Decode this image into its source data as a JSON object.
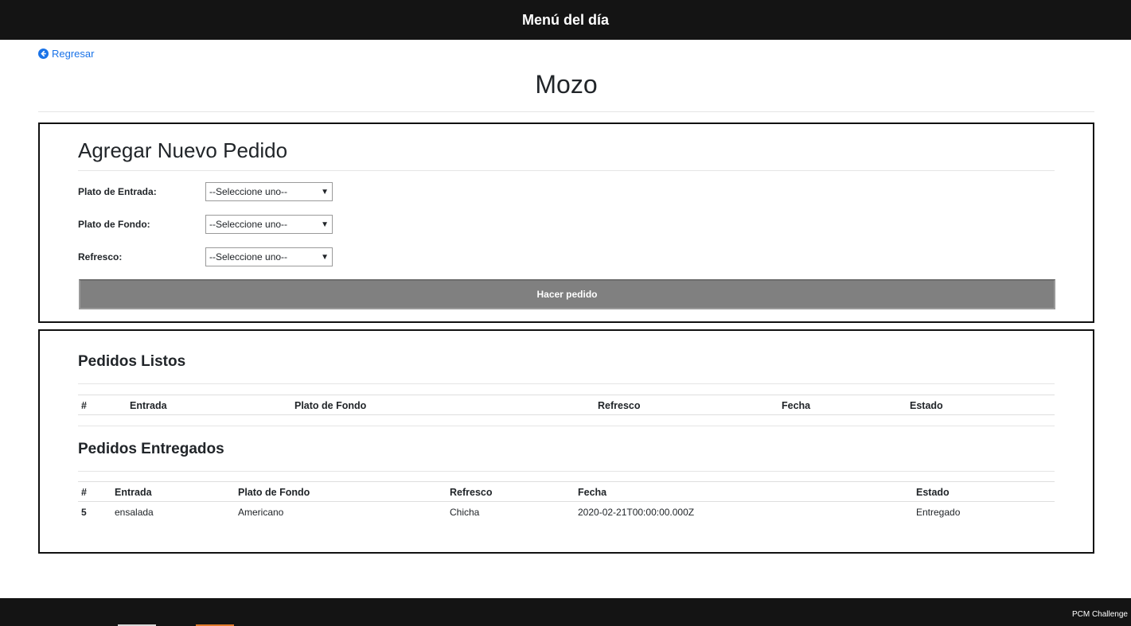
{
  "header": {
    "title": "Menú del día"
  },
  "nav": {
    "back_label": "Regresar",
    "back_icon": "arrow-circle-left-icon"
  },
  "page": {
    "title": "Mozo"
  },
  "form": {
    "title": "Agregar Nuevo Pedido",
    "fields": [
      {
        "label": "Plato de Entrada:",
        "selected": "--Seleccione uno--"
      },
      {
        "label": "Plato de Fondo:",
        "selected": "--Seleccione uno--"
      },
      {
        "label": "Refresco:",
        "selected": "--Seleccione uno--"
      }
    ],
    "submit_label": "Hacer pedido"
  },
  "ready": {
    "title": "Pedidos Listos",
    "columns": [
      "#",
      "Entrada",
      "Plato de Fondo",
      "Refresco",
      "Fecha",
      "Estado"
    ],
    "rows": []
  },
  "delivered": {
    "title": "Pedidos Entregados",
    "columns": [
      "#",
      "Entrada",
      "Plato de Fondo",
      "Refresco",
      "Fecha",
      "Estado"
    ],
    "rows": [
      [
        "5",
        "ensalada",
        "Americano",
        "Chicha",
        "2020-02-21T00:00:00.000Z",
        "Entregado"
      ]
    ]
  },
  "footer": {
    "text": "PCM Challenge"
  },
  "colors": {
    "bar": "#141414",
    "link": "#1a73e8",
    "button": "#808080",
    "accent": "#e07a2a"
  }
}
